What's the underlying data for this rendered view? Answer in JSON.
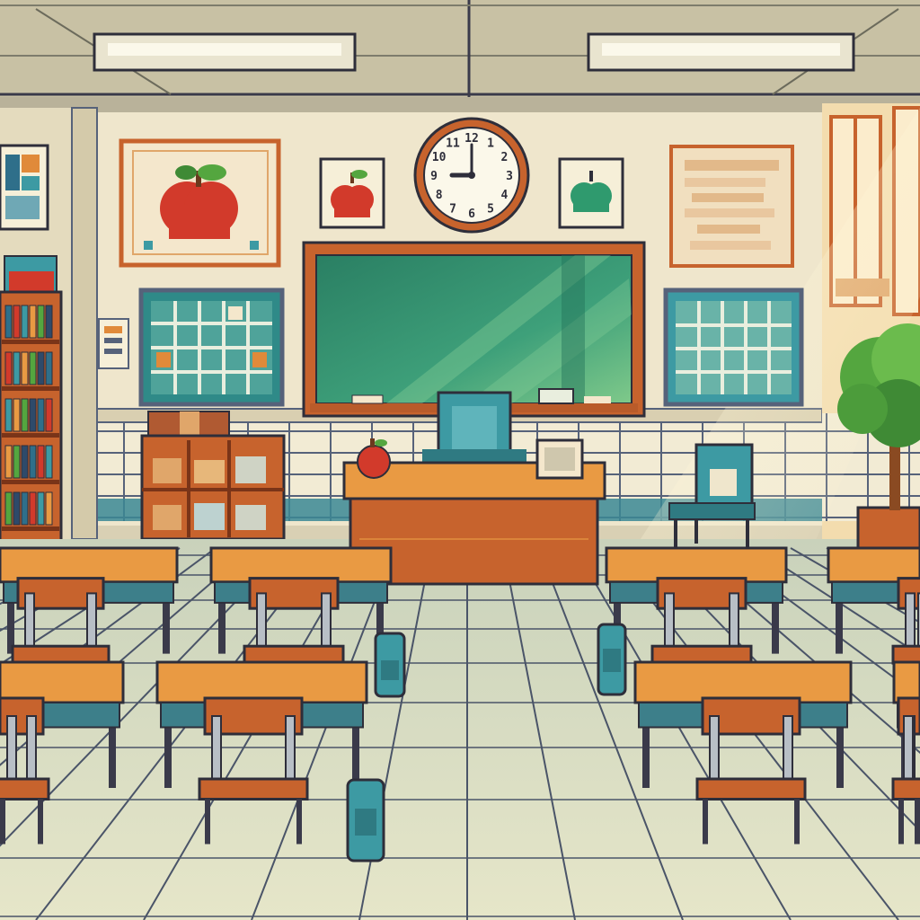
{
  "scene": {
    "clock": {
      "hour_numerals": [
        "12",
        "1",
        "2",
        "3",
        "4",
        "5",
        "6",
        "7",
        "8",
        "9",
        "10",
        "11"
      ],
      "hour_hand": 9,
      "minute_hand": 0
    },
    "palette": {
      "ceiling": "#c9c3a8",
      "wall": "#efe6cc",
      "wall_tile": "#f4eedb",
      "wall_tile_line": "#3c4a64",
      "floor": "#d8dcc0",
      "floor_line": "#4a5468",
      "wood": "#c7632d",
      "wood_light": "#e99a43",
      "chalkboard": "#2f8f6a",
      "chalkboard_light": "#65b97d",
      "teal": "#3d9aa3",
      "apple_red": "#d23a2b",
      "leaf_green": "#54a63f",
      "outline": "#2e2e3a"
    },
    "icons": [
      "apple-poster-icon",
      "apple-icon",
      "clock-icon",
      "chalkboard-icon",
      "bookshelf-icon",
      "desk-icon",
      "chair-icon",
      "backpack-icon",
      "plant-icon",
      "window-icon"
    ]
  }
}
